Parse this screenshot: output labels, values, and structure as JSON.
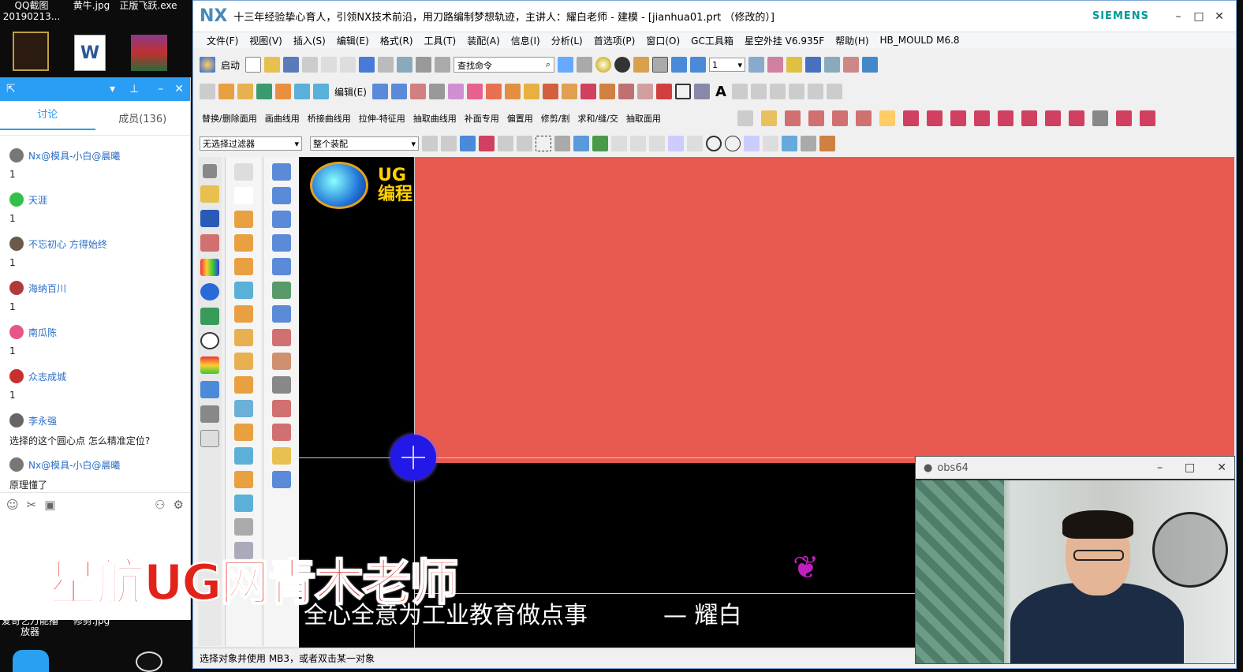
{
  "desktop": {
    "icons": [
      {
        "label": "QQ截图\n20190213...",
        "name": "qq-screenshot"
      },
      {
        "label": "黄牛.jpg",
        "name": "jpg-file"
      },
      {
        "label": "正版飞跃.exe",
        "name": "exe-file"
      },
      {
        "label": "爱奇艺万能播放器",
        "name": "iqiyi-player"
      },
      {
        "label": "修剪.jpg",
        "name": "trim-jpg"
      }
    ]
  },
  "chat": {
    "tabs": [
      "讨论",
      "成员(136)"
    ],
    "messages": [
      {
        "user": "Nx@模具-小白@晨曦",
        "text": "1",
        "color": "#777777"
      },
      {
        "user": "天涯",
        "text": "1",
        "color": "#33c04a"
      },
      {
        "user": "不忘初心 方得始终",
        "text": "1",
        "color": "#6a5a4a"
      },
      {
        "user": "海纳百川",
        "text": "1",
        "color": "#b03a3a"
      },
      {
        "user": "南瓜陈",
        "text": "1",
        "color": "#e8558a"
      },
      {
        "user": "众志成城",
        "text": "1",
        "color": "#c83030"
      },
      {
        "user": "李永强",
        "text": "选择的这个圆心点 怎么精准定位?",
        "color": "#666666"
      },
      {
        "user": "Nx@模具-小白@晨曦",
        "text": "原理懂了",
        "color": "#777777"
      }
    ]
  },
  "watermark": "星航UG网青木老师",
  "nx": {
    "logo": "NX",
    "title": "十三年经验挚心育人，引领NX技术前沿，用刀路编制梦想轨迹，主讲人：耀白老师 - 建模 - [jianhua01.prt （修改的）]",
    "brand": "SIEMENS",
    "menu": [
      "文件(F)",
      "视图(V)",
      "插入(S)",
      "编辑(E)",
      "格式(R)",
      "工具(T)",
      "装配(A)",
      "信息(I)",
      "分析(L)",
      "首选项(P)",
      "窗口(O)",
      "GC工具箱",
      "星空外挂 V6.935F",
      "帮助(H)",
      "HB_MOULD M6.8"
    ],
    "toolbar1": {
      "start": "启动",
      "search_placeholder": "查找命令",
      "layer": "1"
    },
    "toolbar2": {
      "edit": "编辑(E)"
    },
    "toolbar3": [
      "替换/删除面用",
      "画曲线用",
      "桥接曲线用",
      "拉伸-特征用",
      "抽取曲线用",
      "补面专用",
      "偏置用",
      "修剪/割",
      "求和/缝/交",
      "抽取面用"
    ],
    "filter": "无选择过滤器",
    "assembly": "整个装配",
    "canvas": {
      "ug_text": "UG\n编程",
      "motto": "全心全意为工业教育做点事",
      "signature": "— 耀白"
    },
    "status": "选择对象并使用 MB3，或者双击某一对象"
  },
  "obs": {
    "title": "obs64"
  }
}
